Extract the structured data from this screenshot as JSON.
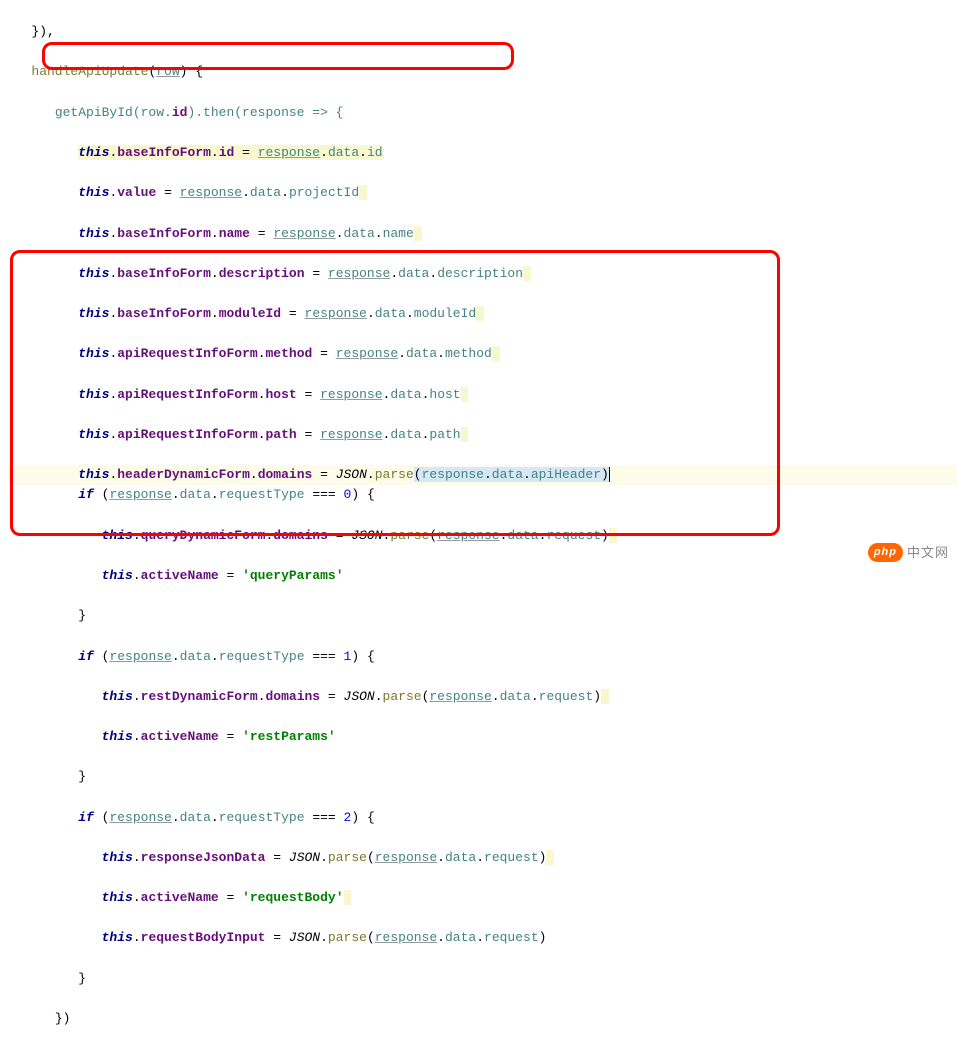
{
  "code": {
    "l0": "}),",
    "fn_name": "handleApiUpdate",
    "fn_param": "row",
    "call_open": "getApiById(row.",
    "call_id": "id",
    "call_then": ").then(response => {",
    "a1_lhs": "this",
    "a1_p1": "baseInfoForm",
    "a1_p2": "id",
    "a1_rhs1": "response",
    "a1_rhs2": "data",
    "a1_rhs3": "id",
    "a2_p1": "value",
    "a2_rhs1": "response",
    "a2_rhs2": "data",
    "a2_rhs3": "projectId",
    "a3_p1": "baseInfoForm",
    "a3_p2": "name",
    "a3_rhs1": "response",
    "a3_rhs2": "data",
    "a3_rhs3": "name",
    "a4_p1": "baseInfoForm",
    "a4_p2": "description",
    "a4_rhs1": "response",
    "a4_rhs2": "data",
    "a4_rhs3": "description",
    "a5_p1": "baseInfoForm",
    "a5_p2": "moduleId",
    "a5_rhs1": "response",
    "a5_rhs2": "data",
    "a5_rhs3": "moduleId",
    "a6_p1": "apiRequestInfoForm",
    "a6_p2": "method",
    "a6_rhs1": "response",
    "a6_rhs2": "data",
    "a6_rhs3": "method",
    "a7_p1": "apiRequestInfoForm",
    "a7_p2": "host",
    "a7_rhs1": "response",
    "a7_rhs2": "data",
    "a7_rhs3": "host",
    "a8_p1": "apiRequestInfoForm",
    "a8_p2": "path",
    "a8_rhs1": "response",
    "a8_rhs2": "data",
    "a8_rhs3": "path",
    "a9_p1": "headerDynamicForm",
    "a9_p2": "domains",
    "json_cls": "JSON",
    "json_parse": "parse",
    "a9_arg1": "response",
    "a9_arg2": "data",
    "a9_arg3": "apiHeader",
    "if_kw": "if",
    "if1_c1": "response",
    "if1_c2": "data",
    "if1_c3": "requestType",
    "if1_val": "0",
    "b1_p1": "queryDynamicForm",
    "b1_p2": "domains",
    "b1_arg1": "response",
    "b1_arg2": "data",
    "b1_arg3": "request",
    "activeName": "activeName",
    "str_query": "'queryParams'",
    "if2_val": "1",
    "b2_p1": "restDynamicForm",
    "b2_p2": "domains",
    "str_rest": "'restParams'",
    "if3_val": "2",
    "b3_p1": "responseJsonData",
    "str_body": "'requestBody'",
    "b4_p1": "requestBodyInput",
    "close_brace": "}",
    "close_paren": "})"
  },
  "watermark": {
    "badge": "php",
    "text": "中文网"
  }
}
